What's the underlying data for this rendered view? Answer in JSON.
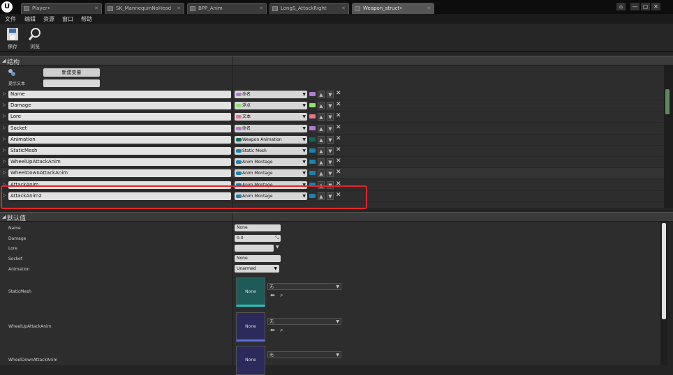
{
  "tabs": [
    {
      "label": "Player•",
      "active": false
    },
    {
      "label": "SK_MannequinNoHead",
      "active": false
    },
    {
      "label": "BPP_Anim",
      "active": false
    },
    {
      "label": "LongS_AttackRight",
      "active": false
    },
    {
      "label": "Weapon_struct•",
      "active": true
    }
  ],
  "window_controls": [
    "—",
    "▢",
    "✕"
  ],
  "menu": [
    "文件",
    "编辑",
    "资源",
    "窗口",
    "帮助"
  ],
  "toolbar": {
    "save": "保存",
    "browse": "浏览"
  },
  "structure": {
    "header": "结构",
    "new_variable": "新建变量",
    "tooltip_label": "提示文本",
    "variables": [
      {
        "name": "Name",
        "type": "命名",
        "color": "#b07bd6"
      },
      {
        "name": "Damage",
        "type": "浮点",
        "color": "#8fe46a"
      },
      {
        "name": "Lore",
        "type": "文本",
        "color": "#e07890"
      },
      {
        "name": "Socket",
        "type": "命名",
        "color": "#b07bd6"
      },
      {
        "name": "Animation",
        "type": "Weapon Animation",
        "color": "#0a6b5c"
      },
      {
        "name": "StaticMesh",
        "type": "Static Mesh",
        "color": "#1a82b0"
      },
      {
        "name": "WheelUpAttackAnim",
        "type": "Anim Montage",
        "color": "#1a82b0"
      },
      {
        "name": "WheelDownAttackAnim",
        "type": "Anim Montage",
        "color": "#1a82b0"
      },
      {
        "name": "AttackAnim",
        "type": "Anim Montage",
        "color": "#1a82b0"
      },
      {
        "name": "AttackAnim2",
        "type": "Anim Montage",
        "color": "#1a82b0"
      }
    ]
  },
  "defaults": {
    "header": "默认值",
    "name_label": "Name",
    "name_value": "None",
    "damage_label": "Damage",
    "damage_value": "0.0",
    "lore_label": "Lore",
    "socket_label": "Socket",
    "socket_value": "None",
    "animation_label": "Animation",
    "animation_value": "Unarmed",
    "staticmesh_label": "StaticMesh",
    "wheelup_label": "WheelUpAttackAnim",
    "wheeldown_label": "WheelDownAttackAnim",
    "thumb_text": "None",
    "asset_none": "无"
  }
}
